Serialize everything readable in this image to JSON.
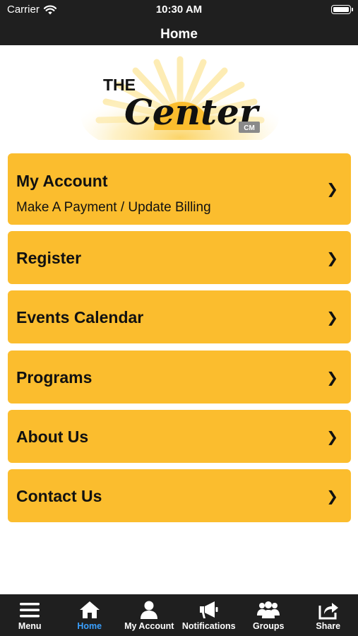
{
  "status_bar": {
    "carrier": "Carrier",
    "time": "10:30 AM"
  },
  "nav": {
    "title": "Home"
  },
  "logo": {
    "line1": "THE",
    "line2": "Center",
    "badge": "CM"
  },
  "menu": [
    {
      "label": "My Account",
      "subtitle": "Make A Payment / Update Billing"
    },
    {
      "label": "Register"
    },
    {
      "label": "Events Calendar"
    },
    {
      "label": "Programs"
    },
    {
      "label": "About Us"
    },
    {
      "label": "Contact Us"
    }
  ],
  "chevron": "❯",
  "tabs": [
    {
      "label": "Menu",
      "icon": "hamburger-icon"
    },
    {
      "label": "Home",
      "icon": "home-icon",
      "active": true
    },
    {
      "label": "My Account",
      "icon": "person-icon"
    },
    {
      "label": "Notifications",
      "icon": "megaphone-icon"
    },
    {
      "label": "Groups",
      "icon": "group-icon"
    },
    {
      "label": "Share",
      "icon": "share-icon"
    }
  ],
  "colors": {
    "bar_bg": "#1f1f1f",
    "card_bg": "#fbbd2e",
    "active_tab": "#3aa0ff"
  }
}
